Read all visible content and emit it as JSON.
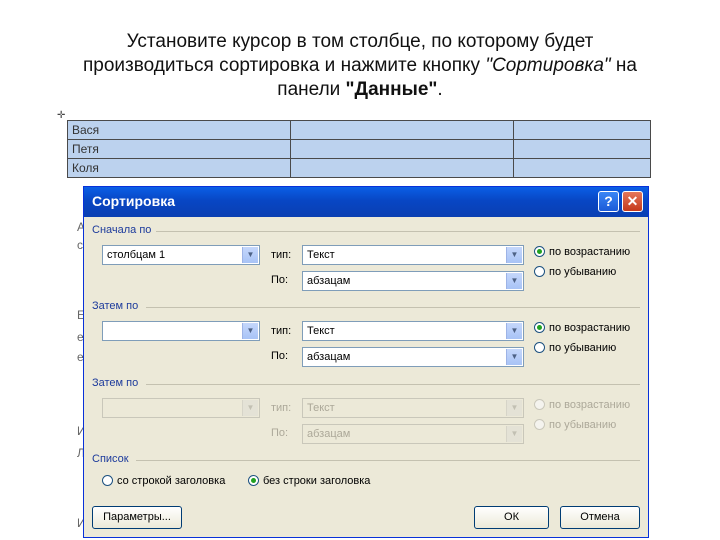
{
  "caption": {
    "line1": "Установите курсор в том столбце, по которому будет",
    "line2_start": "производиться сортировка и нажмите кнопку ",
    "line2_quote": "\"Сортировка\"",
    "line2_end": " на",
    "line3_start": "панели ",
    "line3_bold": "\"Данные\"",
    "line3_end": "."
  },
  "table": {
    "rows": [
      [
        "Вася",
        "",
        ""
      ],
      [
        "Петя",
        "",
        ""
      ],
      [
        "Коля",
        "",
        ""
      ]
    ]
  },
  "dialog": {
    "title": "Сортировка",
    "help_label": "?",
    "close_label": "✕",
    "first_by": {
      "group_label": "Сначала по",
      "field": "столбцам 1",
      "type_label": "тип:",
      "type_value": "Текст",
      "by_label": "По:",
      "by_value": "абзацам",
      "asc_label": "по возрастанию",
      "desc_label": "по убыванию",
      "selected": "asc"
    },
    "then_by_1": {
      "group_label": "Затем по",
      "field": "",
      "type_label": "тип:",
      "type_value": "Текст",
      "by_label": "По:",
      "by_value": "абзацам",
      "asc_label": "по возрастанию",
      "desc_label": "по убыванию",
      "selected": "asc"
    },
    "then_by_2": {
      "group_label": "Затем по",
      "field": "",
      "type_label": "тип:",
      "type_value": "Текст",
      "by_label": "По:",
      "by_value": "абзацам",
      "asc_label": "по возрастанию",
      "desc_label": "по убыванию",
      "disabled": true
    },
    "list": {
      "group_label": "Список",
      "with_header_label": "со строкой заголовка",
      "without_header_label": "без строки заголовка",
      "selected": "without_header"
    },
    "buttons": {
      "options": "Параметры...",
      "ok": "ОК",
      "cancel": "Отмена"
    }
  },
  "side_letters": [
    "А",
    "с",
    "Е",
    "е",
    "е",
    "И",
    "Л",
    "И"
  ]
}
